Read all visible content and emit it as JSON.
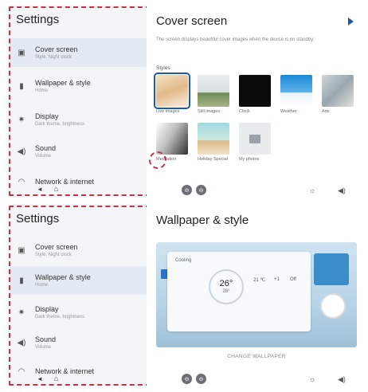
{
  "colors": {
    "accent": "#1e5aa8",
    "highlight_dash": "#c0344a",
    "sidebar_bg": "#f4f5f7",
    "active_item_bg": "#e4eaf3"
  },
  "sidebar": {
    "title": "Settings",
    "items": [
      {
        "label": "Cover screen",
        "sub": "Style, Night clock",
        "icon": "cover-screen-icon"
      },
      {
        "label": "Wallpaper & style",
        "sub": "Home",
        "icon": "wallpaper-icon"
      },
      {
        "label": "Display",
        "sub": "Dark theme, brightness",
        "icon": "display-icon"
      },
      {
        "label": "Sound",
        "sub": "Volume",
        "icon": "sound-icon"
      },
      {
        "label": "Network & internet",
        "sub": "",
        "icon": "network-icon"
      }
    ],
    "nav": {
      "back": "◄",
      "home": "⌂"
    }
  },
  "cover_screen": {
    "title": "Cover screen",
    "description": "The screen displays beautiful cover images when the device is on standby.",
    "styles_label": "Styles",
    "styles": [
      {
        "label": "Live images",
        "selected": true
      },
      {
        "label": "Still images"
      },
      {
        "label": "Clock"
      },
      {
        "label": "Weather"
      },
      {
        "label": "Arts"
      },
      {
        "label": "Meditation"
      },
      {
        "label": "Holiday Special"
      },
      {
        "label": "My photos"
      }
    ]
  },
  "wallpaper": {
    "title": "Wallpaper & style",
    "preview": {
      "mode": "Cooling",
      "temp": "26",
      "temp_unit": "°",
      "set_temp": "28°",
      "stats": [
        "21 ℃",
        "+1",
        "Off"
      ]
    },
    "change_label": "CHANGE WALLPAPER"
  },
  "controls": {
    "left_button": "⊖",
    "right_button": "⊖",
    "brightness_icon": "☼",
    "volume_icon": "◀)"
  }
}
